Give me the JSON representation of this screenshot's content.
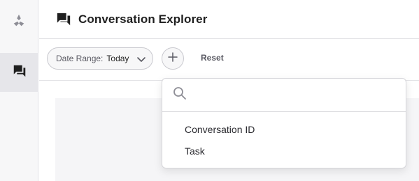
{
  "rail": {
    "logo_icon": "brand-logo-icon",
    "items": [
      {
        "icon": "conversations-icon",
        "active": true
      }
    ]
  },
  "header": {
    "title_icon": "conversations-icon",
    "title": "Conversation Explorer"
  },
  "filters": {
    "date_range": {
      "label": "Date Range:",
      "value": "Today",
      "icon": "chevron-down-icon"
    },
    "add_filter_icon": "plus-icon",
    "reset_label": "Reset"
  },
  "dropdown": {
    "search_icon": "search-icon",
    "search_value": "",
    "search_placeholder": "",
    "options": [
      "Conversation ID",
      "Task"
    ]
  },
  "colors": {
    "rail_bg": "#f7f7f8",
    "rail_active_bg": "#e6e6ea",
    "border": "#e3e3e6",
    "text": "#1f1f1f",
    "muted_text": "#5a5a63",
    "icon_gray": "#8e8e96"
  }
}
